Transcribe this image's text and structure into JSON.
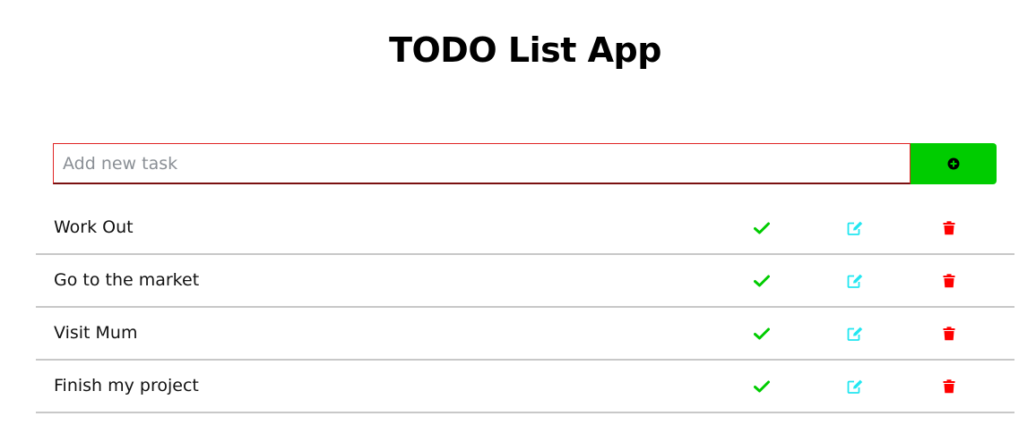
{
  "header": {
    "title": "TODO List App"
  },
  "new_task": {
    "placeholder": "Add new task",
    "value": "",
    "add_button_icon": "plus-circle-icon"
  },
  "colors": {
    "accent_green": "#00cc00",
    "edit_cyan": "#22e6f0",
    "delete_red": "#ff0000",
    "input_border": "#e02424"
  },
  "tasks": [
    {
      "label": "Work Out"
    },
    {
      "label": "Go to the market"
    },
    {
      "label": "Visit Mum"
    },
    {
      "label": "Finish my project"
    }
  ],
  "row_icons": {
    "complete": "check-icon",
    "edit": "edit-icon",
    "delete": "trash-icon"
  }
}
